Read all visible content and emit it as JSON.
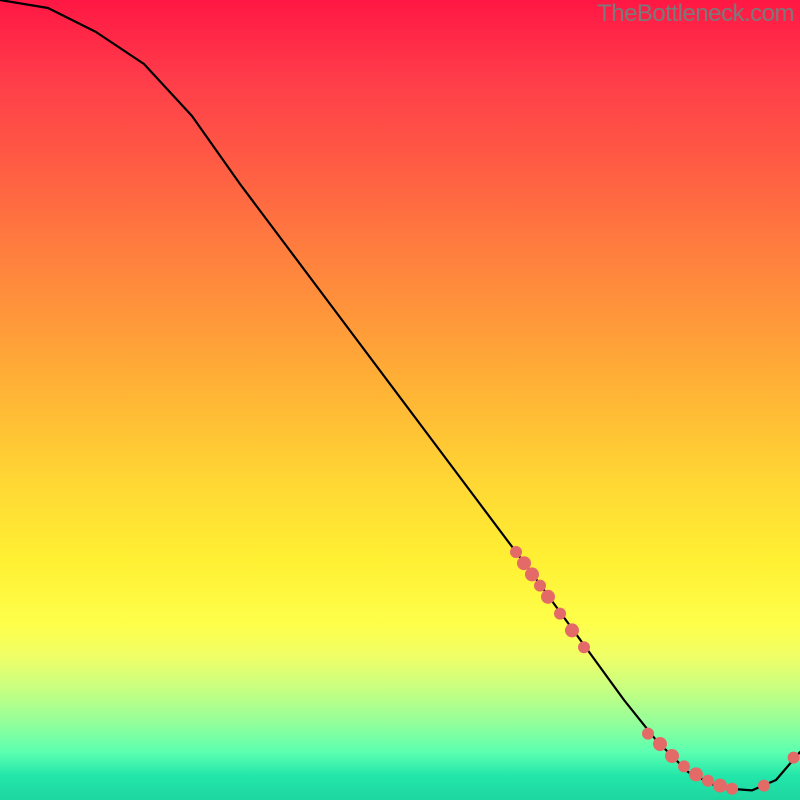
{
  "watermark": "TheBottleneck.com",
  "chart_data": {
    "type": "line",
    "title": "",
    "xlabel": "",
    "ylabel": "",
    "xlim": [
      0,
      100
    ],
    "ylim": [
      0,
      100
    ],
    "series": [
      {
        "name": "bottleneck-curve",
        "x": [
          0,
          6,
          12,
          18,
          24,
          30,
          36,
          42,
          48,
          54,
          60,
          66,
          70,
          74,
          78,
          82,
          86,
          90,
          94,
          97,
          100
        ],
        "values": [
          100,
          99,
          96,
          92,
          85.5,
          77,
          69,
          61,
          53,
          45,
          37,
          29,
          23.5,
          18,
          12.5,
          7.5,
          3.5,
          1.5,
          1.2,
          2.5,
          6
        ]
      }
    ],
    "marker_clusters": [
      {
        "name": "cluster-upper",
        "color": "#e46a68",
        "points": [
          {
            "x": 64.5,
            "y": 31.0,
            "r": 6
          },
          {
            "x": 65.5,
            "y": 29.6,
            "r": 7
          },
          {
            "x": 66.5,
            "y": 28.2,
            "r": 7
          },
          {
            "x": 67.5,
            "y": 26.8,
            "r": 6
          },
          {
            "x": 68.5,
            "y": 25.4,
            "r": 7
          },
          {
            "x": 70.0,
            "y": 23.3,
            "r": 6
          },
          {
            "x": 71.5,
            "y": 21.2,
            "r": 7
          },
          {
            "x": 73.0,
            "y": 19.1,
            "r": 6
          }
        ]
      },
      {
        "name": "cluster-lower",
        "color": "#e46a68",
        "points": [
          {
            "x": 81.0,
            "y": 8.3,
            "r": 6
          },
          {
            "x": 82.5,
            "y": 7.0,
            "r": 7
          },
          {
            "x": 84.0,
            "y": 5.5,
            "r": 7
          },
          {
            "x": 85.5,
            "y": 4.2,
            "r": 6
          },
          {
            "x": 87.0,
            "y": 3.2,
            "r": 7
          },
          {
            "x": 88.5,
            "y": 2.4,
            "r": 6
          },
          {
            "x": 90.0,
            "y": 1.8,
            "r": 7
          },
          {
            "x": 91.5,
            "y": 1.4,
            "r": 6
          },
          {
            "x": 95.5,
            "y": 1.8,
            "r": 6
          },
          {
            "x": 99.2,
            "y": 5.3,
            "r": 6
          }
        ]
      }
    ]
  }
}
